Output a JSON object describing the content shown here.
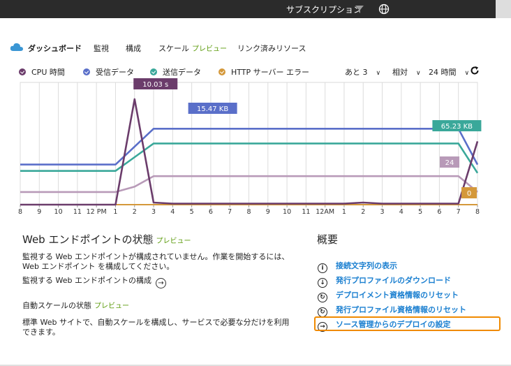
{
  "topbar": {
    "subscription_label": "サブスクリプション",
    "filter_icon": "filter-icon",
    "globe_icon": "globe-icon"
  },
  "tabs": [
    {
      "label": "ダッシュボード",
      "active": true
    },
    {
      "label": "監視"
    },
    {
      "label": "構成"
    },
    {
      "label": "スケール",
      "badge": "プレビュー"
    },
    {
      "label": "リンク済みリソース"
    }
  ],
  "legend": {
    "items": [
      {
        "label": "CPU 時間",
        "color": "#6b3c6b"
      },
      {
        "label": "受信データ",
        "color": "#5a6fc9"
      },
      {
        "label": "送信データ",
        "color": "#3aa89a"
      },
      {
        "label": "HTTP サーバー エラー",
        "color": "#d4983a"
      }
    ],
    "controls": {
      "more": "あと 3",
      "scale": "相対",
      "range": "24 時間"
    }
  },
  "chart_data": {
    "type": "line",
    "x": [
      "8",
      "9",
      "10",
      "11",
      "12 PM",
      "1",
      "2",
      "3",
      "4",
      "5",
      "6",
      "7",
      "8",
      "9",
      "10",
      "11",
      "12AM",
      "1",
      "2",
      "3",
      "4",
      "5",
      "6",
      "7",
      "8"
    ],
    "callouts": [
      "10.03 s",
      "15.47 KB",
      "65.23 KB",
      "24",
      "0"
    ],
    "series": [
      {
        "name": "CPU 時間",
        "color": "#6b3c6b",
        "values": [
          0,
          0,
          0,
          0,
          0,
          0,
          100,
          2,
          1,
          1,
          1,
          1,
          1,
          1,
          1,
          1,
          1,
          1,
          2,
          1,
          1,
          1,
          1,
          1,
          60
        ]
      },
      {
        "name": "受信データ",
        "color": "#5a6fc9",
        "values": [
          38,
          38,
          38,
          38,
          38,
          38,
          55,
          72,
          72,
          72,
          72,
          72,
          72,
          72,
          72,
          72,
          72,
          72,
          72,
          72,
          72,
          72,
          72,
          72,
          38
        ]
      },
      {
        "name": "送信データ",
        "color": "#3aa89a",
        "values": [
          32,
          32,
          32,
          32,
          32,
          32,
          45,
          58,
          58,
          58,
          58,
          58,
          58,
          58,
          58,
          58,
          58,
          58,
          58,
          58,
          58,
          58,
          58,
          58,
          30
        ]
      },
      {
        "name": "",
        "color": "#b89ab8",
        "values": [
          12,
          12,
          12,
          12,
          12,
          12,
          17,
          27,
          27,
          27,
          27,
          27,
          27,
          27,
          27,
          27,
          27,
          27,
          27,
          27,
          27,
          27,
          27,
          27,
          12
        ]
      },
      {
        "name": "HTTP サーバー エラー",
        "color": "#d4983a",
        "values": [
          0,
          0,
          0,
          0,
          0,
          0,
          0,
          0,
          0,
          0,
          0,
          0,
          0,
          0,
          0,
          0,
          0,
          0,
          0,
          0,
          0,
          0,
          0,
          0,
          0
        ]
      }
    ],
    "ylim": [
      0,
      100
    ]
  },
  "web_endpoint": {
    "title": "Web エンドポイントの状態",
    "badge": "プレビュー",
    "line1": "監視する Web エンドポイントが構成されていません。作業を開始するには、",
    "line2": "Web エンドポイント を構成してください。",
    "link": "監視する Web エンドポイントの構成"
  },
  "autoscale": {
    "title": "自動スケールの状態",
    "badge": "プレビュー",
    "line1": "標準 Web サイトで、自動スケールを構成し、サービスで必要な分だけを利用",
    "line2": "できます。"
  },
  "overview": {
    "title": "概要",
    "items": [
      {
        "label": "接続文字列の表示",
        "icon": "i"
      },
      {
        "label": "発行プロファイルのダウンロード",
        "icon": "↓"
      },
      {
        "label": "デプロイメント資格情報のリセット",
        "icon": "↻"
      },
      {
        "label": "発行プロファイル資格情報のリセット",
        "icon": "↻"
      },
      {
        "label": "ソース管理からのデプロイの設定",
        "icon": "→"
      }
    ]
  }
}
